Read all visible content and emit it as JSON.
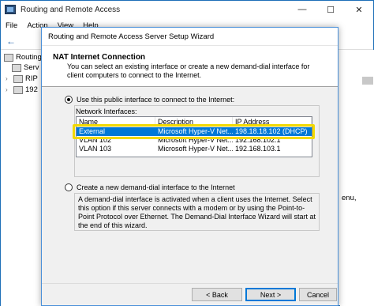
{
  "mmc": {
    "title": "Routing and Remote Access",
    "controls": {
      "minimize": "—",
      "maximize": "☐",
      "close": "✕"
    },
    "menu": [
      "File",
      "Action",
      "View",
      "Help"
    ],
    "tree": [
      "Routing",
      "Serv",
      "RIP",
      "192"
    ],
    "right_text": "enu,"
  },
  "wizard": {
    "title": "Routing and Remote Access Server Setup Wizard",
    "heading": "NAT Internet Connection",
    "subtext": "You can select an existing interface or create a new demand-dial interface for client computers to connect to the Internet.",
    "option_public": "Use this public interface to connect to the Internet:",
    "network_interfaces_label": "Network Interfaces:",
    "columns": [
      "Name",
      "Description",
      "IP Address"
    ],
    "rows": [
      {
        "name": "External",
        "description": "Microsoft Hyper-V Net...",
        "ip": "198.18.18.102 (DHCP)",
        "selected": true
      },
      {
        "name": "VLAN 102",
        "description": "Microsoft Hyper-V Net...",
        "ip": "192.168.102.1",
        "selected": false
      },
      {
        "name": "VLAN 103",
        "description": "Microsoft Hyper-V Net...",
        "ip": "192.168.103.1",
        "selected": false
      }
    ],
    "option_demand_dial": "Create a new demand-dial interface to the Internet",
    "description": "A demand-dial interface is activated when a client uses the Internet. Select this option if this server connects with a modem or by using the Point-to-Point Protocol over Ethernet. The Demand-Dial Interface Wizard will start at the end of this wizard.",
    "buttons": {
      "back": "< Back",
      "next": "Next >",
      "cancel": "Cancel"
    }
  },
  "colors": {
    "selection": "#0078d7",
    "highlight": "#f2d900",
    "accent": "#4a90d9"
  }
}
